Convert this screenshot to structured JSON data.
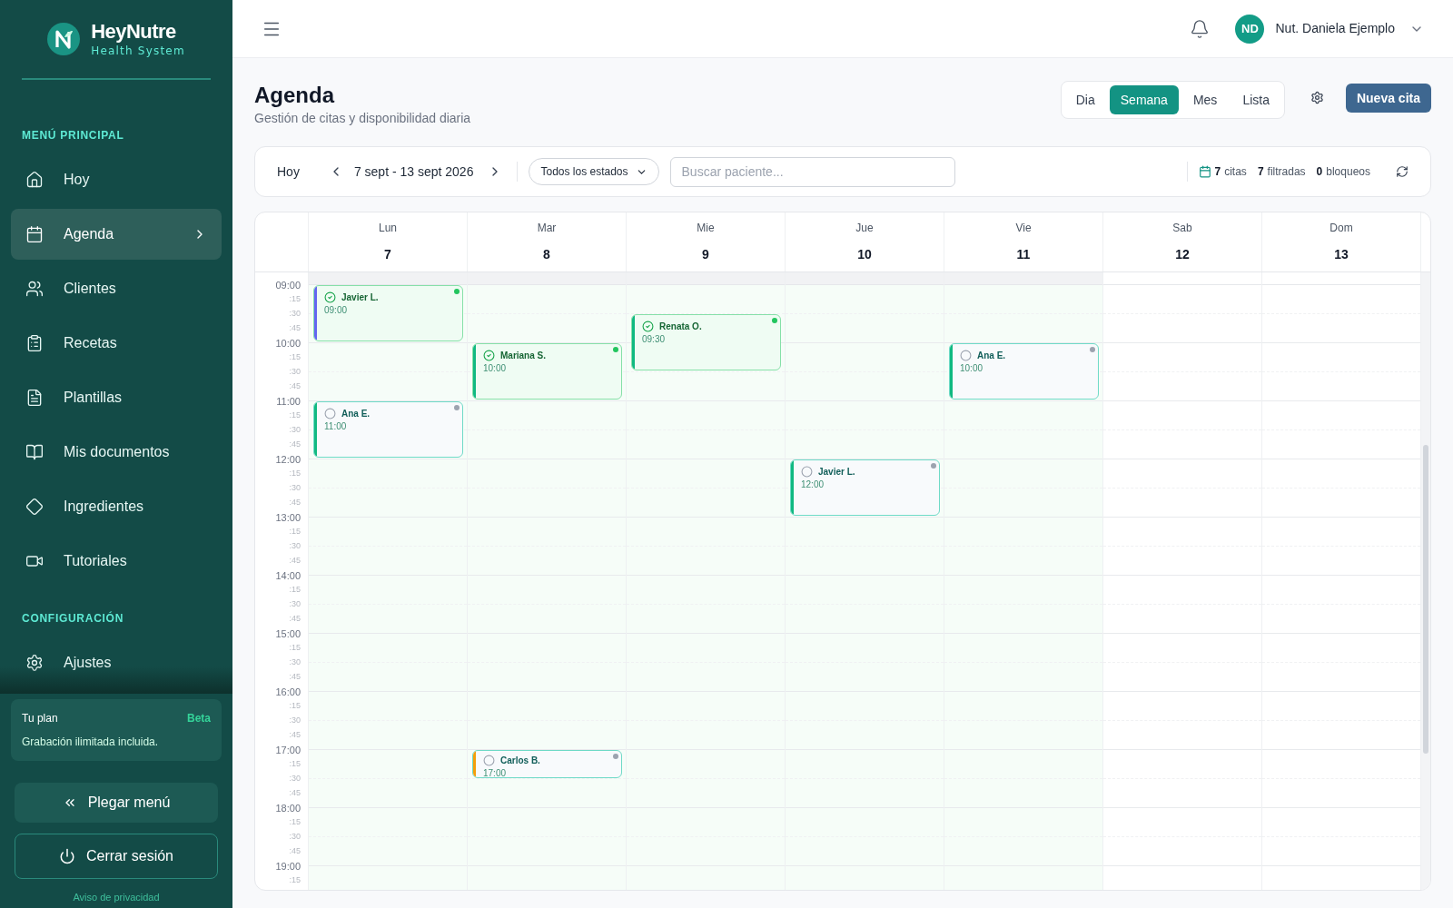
{
  "brand": {
    "name": "HeyNutre",
    "tagline": "Health System"
  },
  "sidebar": {
    "sections": [
      {
        "title": "MENÚ PRINCIPAL",
        "items": [
          {
            "label": "Hoy",
            "selected": false
          },
          {
            "label": "Agenda",
            "selected": true
          },
          {
            "label": "Clientes",
            "selected": false
          },
          {
            "label": "Recetas",
            "selected": false
          },
          {
            "label": "Plantillas",
            "selected": false
          },
          {
            "label": "Mis documentos",
            "selected": false
          },
          {
            "label": "Ingredientes",
            "selected": false
          },
          {
            "label": "Tutoriales",
            "selected": false
          }
        ]
      },
      {
        "title": "CONFIGURACIÓN",
        "items": [
          {
            "label": "Ajustes",
            "selected": false
          }
        ]
      }
    ],
    "plan": {
      "title": "Tu plan",
      "badge": "Beta",
      "text": "Grabación ilimitada incluida."
    },
    "collapse_button": "Plegar menú",
    "logout_button": "Cerrar sesión",
    "privacy_link": "Aviso de privacidad"
  },
  "topbar": {
    "user_initials": "ND",
    "user_name": "Nut. Daniela Ejemplo"
  },
  "page": {
    "title": "Agenda",
    "subtitle": "Gestión de citas y disponibilidad diaria",
    "views": [
      {
        "label": "Dia",
        "selected": false
      },
      {
        "label": "Semana",
        "selected": true
      },
      {
        "label": "Mes",
        "selected": false
      },
      {
        "label": "Lista",
        "selected": false
      }
    ],
    "new_button": "Nueva cita"
  },
  "toolbar": {
    "today_button": "Hoy",
    "range": "7 sept - 13 sept 2026",
    "status_filter": "Todos los estados",
    "search": {
      "placeholder": "Buscar paciente..."
    },
    "stats": [
      {
        "count": "7",
        "label": "citas"
      },
      {
        "count": "7",
        "label": "filtradas"
      },
      {
        "count": "0",
        "label": "bloqueos"
      }
    ]
  },
  "calendar": {
    "hours": [
      {
        "label": "09:00",
        "marks": [
          ":15",
          ":30",
          ":45"
        ]
      },
      {
        "label": "10:00",
        "marks": [
          ":15",
          ":30",
          ":45"
        ]
      },
      {
        "label": "11:00",
        "marks": [
          ":15",
          ":30",
          ":45"
        ]
      },
      {
        "label": "12:00",
        "marks": [
          ":15",
          ":30",
          ":45"
        ]
      },
      {
        "label": "13:00",
        "marks": [
          ":15",
          ":30",
          ":45"
        ]
      },
      {
        "label": "14:00",
        "marks": [
          ":15",
          ":30",
          ":45"
        ]
      },
      {
        "label": "15:00",
        "marks": [
          ":15",
          ":30",
          ":45"
        ]
      },
      {
        "label": "16:00",
        "marks": [
          ":15",
          ":30",
          ":45"
        ]
      },
      {
        "label": "17:00",
        "marks": [
          ":15",
          ":30",
          ":45"
        ]
      },
      {
        "label": "18:00",
        "marks": [
          ":15",
          ":30",
          ":45"
        ]
      },
      {
        "label": "19:00",
        "marks": [
          ":15"
        ]
      }
    ],
    "days": [
      {
        "name": "Lun",
        "date": "7",
        "working": true,
        "events": [
          {
            "patient": "Javier L.",
            "time": "09:00",
            "confirmed": true,
            "kind": "hour",
            "color": "#6366f1"
          },
          {
            "patient": "Ana E.",
            "time": "11:00",
            "confirmed": false,
            "kind": "hour",
            "color": "#10b981"
          }
        ]
      },
      {
        "name": "Mar",
        "date": "8",
        "working": true,
        "events": [
          {
            "patient": "Mariana S.",
            "time": "10:00",
            "confirmed": true,
            "kind": "hour",
            "color": "#10b981"
          },
          {
            "patient": "Carlos B.",
            "time": "17:00",
            "confirmed": false,
            "kind": "half",
            "color": "#f59e0b"
          }
        ]
      },
      {
        "name": "Mie",
        "date": "9",
        "working": true,
        "events": [
          {
            "patient": "Renata O.",
            "time": "09:30",
            "confirmed": true,
            "kind": "hour",
            "color": "#10b981"
          }
        ]
      },
      {
        "name": "Jue",
        "date": "10",
        "working": true,
        "events": [
          {
            "patient": "Javier L.",
            "time": "12:00",
            "confirmed": false,
            "kind": "hour",
            "color": "#10b981"
          }
        ]
      },
      {
        "name": "Vie",
        "date": "11",
        "working": true,
        "events": [
          {
            "patient": "Ana E.",
            "time": "10:00",
            "confirmed": false,
            "kind": "hour",
            "color": "#10b981"
          }
        ]
      },
      {
        "name": "Sab",
        "date": "12",
        "working": false
      },
      {
        "name": "Dom",
        "date": "13",
        "working": false
      }
    ]
  }
}
